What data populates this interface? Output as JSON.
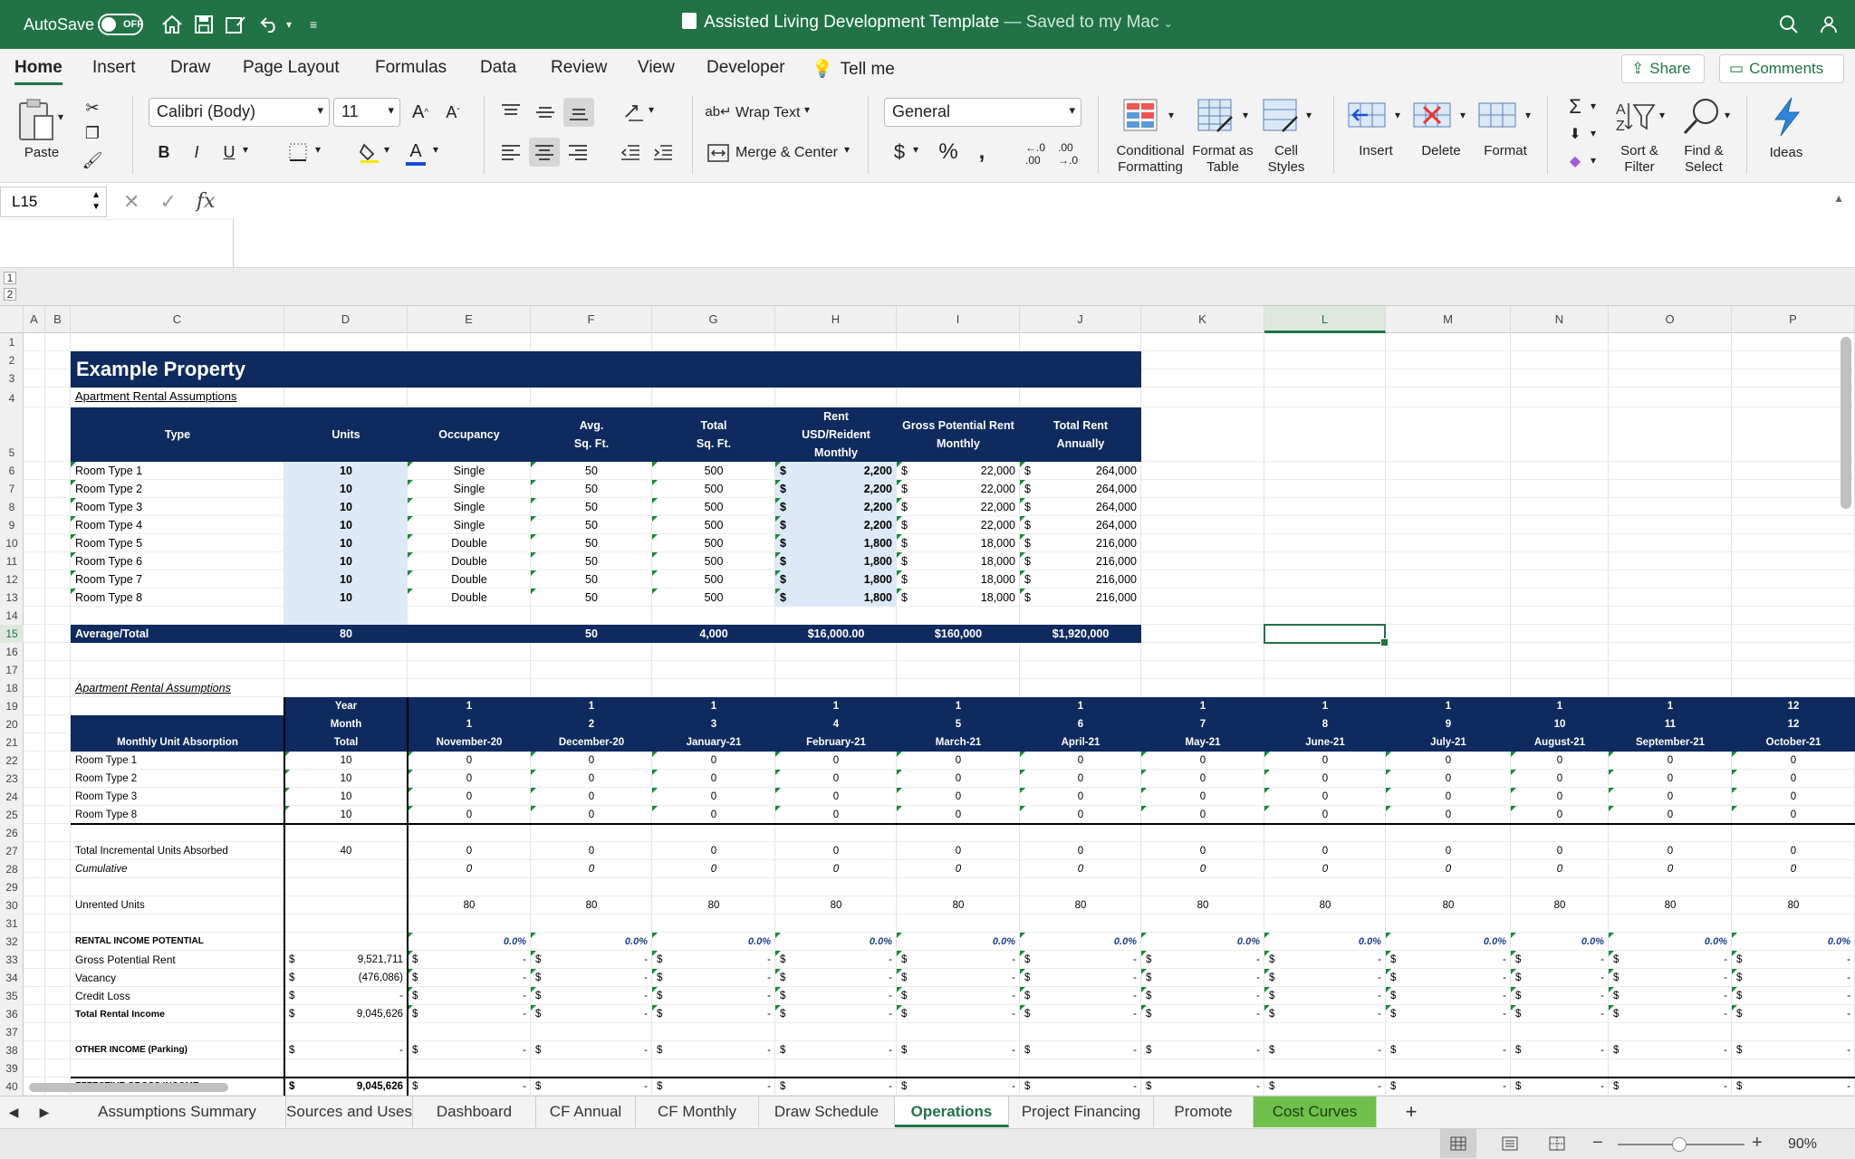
{
  "titlebar": {
    "autosave_label": "AutoSave",
    "autosave_state": "OFF",
    "doc_title": "Assisted Living Development Template",
    "saved_status": "— Saved to my Mac"
  },
  "ribbon_tabs": [
    "Home",
    "Insert",
    "Draw",
    "Page Layout",
    "Formulas",
    "Data",
    "Review",
    "View",
    "Developer",
    "Tell me"
  ],
  "share_label": "Share",
  "comments_label": "Comments",
  "ribbon": {
    "paste": "Paste",
    "font_name": "Calibri (Body)",
    "font_size": "11",
    "wrap_text": "Wrap Text",
    "merge_center": "Merge & Center",
    "number_format": "General",
    "conditional_formatting": "Conditional Formatting",
    "format_as_table": "Format as Table",
    "cell_styles": "Cell Styles",
    "insert": "Insert",
    "delete": "Delete",
    "format": "Format",
    "sort_filter": "Sort & Filter",
    "find_select": "Find & Select",
    "ideas": "Ideas"
  },
  "formula_bar": {
    "name_box": "L15",
    "fx": "fx",
    "value": ""
  },
  "outline_levels": [
    "1",
    "2"
  ],
  "column_letters": [
    "A",
    "B",
    "C",
    "D",
    "E",
    "F",
    "G",
    "H",
    "I",
    "J",
    "K",
    "L",
    "M",
    "N",
    "O",
    "P"
  ],
  "sheet": {
    "title": "Example Property",
    "section1_title": "Apartment Rental Assumptions",
    "headers": {
      "type": "Type",
      "units": "Units",
      "occupancy": "Occupancy",
      "sqft_1": "Avg.",
      "sqft_2": "Sq. Ft.",
      "total_1": "Total",
      "total_2": "Sq. Ft.",
      "rent_1": "Rent",
      "rent_2": "USD/Reident",
      "rent_3": "Monthly",
      "gpr_1": "Gross Potential Rent",
      "gpr_2": "Monthly",
      "tra_1": "Total Rent",
      "tra_2": "Annually"
    },
    "room_rows": [
      [
        "Room Type 1",
        "10",
        "Single",
        "50",
        "500",
        "$",
        "2,200",
        "$",
        "22,000",
        "$",
        "264,000"
      ],
      [
        "Room Type 2",
        "10",
        "Single",
        "50",
        "500",
        "$",
        "2,200",
        "$",
        "22,000",
        "$",
        "264,000"
      ],
      [
        "Room Type 3",
        "10",
        "Single",
        "50",
        "500",
        "$",
        "2,200",
        "$",
        "22,000",
        "$",
        "264,000"
      ],
      [
        "Room Type 4",
        "10",
        "Single",
        "50",
        "500",
        "$",
        "2,200",
        "$",
        "22,000",
        "$",
        "264,000"
      ],
      [
        "Room Type 5",
        "10",
        "Double",
        "50",
        "500",
        "$",
        "1,800",
        "$",
        "18,000",
        "$",
        "216,000"
      ],
      [
        "Room Type 6",
        "10",
        "Double",
        "50",
        "500",
        "$",
        "1,800",
        "$",
        "18,000",
        "$",
        "216,000"
      ],
      [
        "Room Type 7",
        "10",
        "Double",
        "50",
        "500",
        "$",
        "1,800",
        "$",
        "18,000",
        "$",
        "216,000"
      ],
      [
        "Room Type 8",
        "10",
        "Double",
        "50",
        "500",
        "$",
        "1,800",
        "$",
        "18,000",
        "$",
        "216,000"
      ]
    ],
    "total_row": [
      "Average/Total",
      "80",
      "",
      "50",
      "4,000",
      "$16,000.00",
      "$160,000",
      "$1,920,000"
    ],
    "section2_title": "Apartment Rental Assumptions",
    "abs_labels": {
      "year": "Year",
      "month": "Month",
      "total": "Total",
      "monthly_unit_absorption": "Monthly Unit Absorption"
    },
    "years": [
      "1",
      "1",
      "1",
      "1",
      "1",
      "1",
      "1",
      "1",
      "1",
      "1",
      "1",
      "12"
    ],
    "months": [
      "1",
      "2",
      "3",
      "4",
      "5",
      "6",
      "7",
      "8",
      "9",
      "10",
      "11",
      "12"
    ],
    "month_names": [
      "November-20",
      "December-20",
      "January-21",
      "February-21",
      "March-21",
      "April-21",
      "May-21",
      "June-21",
      "July-21",
      "August-21",
      "September-21",
      "October-21"
    ],
    "abs_rows": [
      {
        "label": "Room Type 1",
        "total": "10",
        "values": [
          "0",
          "0",
          "0",
          "0",
          "0",
          "0",
          "0",
          "0",
          "0",
          "0",
          "0",
          "0"
        ]
      },
      {
        "label": "Room Type 2",
        "total": "10",
        "values": [
          "0",
          "0",
          "0",
          "0",
          "0",
          "0",
          "0",
          "0",
          "0",
          "0",
          "0",
          "0"
        ]
      },
      {
        "label": "Room Type 3",
        "total": "10",
        "values": [
          "0",
          "0",
          "0",
          "0",
          "0",
          "0",
          "0",
          "0",
          "0",
          "0",
          "0",
          "0"
        ]
      },
      {
        "label": "Room Type 8",
        "total": "10",
        "values": [
          "0",
          "0",
          "0",
          "0",
          "0",
          "0",
          "0",
          "0",
          "0",
          "0",
          "0",
          "0"
        ]
      }
    ],
    "total_incremental": {
      "label": "Total Incremental Units Absorbed",
      "total": "40",
      "values": [
        "0",
        "0",
        "0",
        "0",
        "0",
        "0",
        "0",
        "0",
        "0",
        "0",
        "0",
        "0"
      ]
    },
    "cumulative": {
      "label": "Cumulative",
      "values": [
        "0",
        "0",
        "0",
        "0",
        "0",
        "0",
        "0",
        "0",
        "0",
        "0",
        "0",
        "0"
      ]
    },
    "unrented": {
      "label": "Unrented Units",
      "values": [
        "80",
        "80",
        "80",
        "80",
        "80",
        "80",
        "80",
        "80",
        "80",
        "80",
        "80",
        "80"
      ]
    },
    "rental_income_potential": "RENTAL INCOME POTENTIAL",
    "pct_values": [
      "0.0%",
      "0.0%",
      "0.0%",
      "0.0%",
      "0.0%",
      "0.0%",
      "0.0%",
      "0.0%",
      "0.0%",
      "0.0%",
      "0.0%",
      "0.0%"
    ],
    "income_rows": [
      {
        "label": "Gross Potential Rent",
        "cur": "$",
        "total": "9,521,711",
        "bold": false
      },
      {
        "label": "Vacancy",
        "cur": "$",
        "total": "(476,086)",
        "bold": false
      },
      {
        "label": "Credit Loss",
        "cur": "$",
        "total": "-",
        "bold": false
      },
      {
        "label": "Total Rental Income",
        "cur": "$",
        "total": "9,045,626",
        "bold": true
      }
    ],
    "other_income": {
      "label": "OTHER INCOME (Parking)",
      "cur": "$",
      "total": "-"
    },
    "egi": {
      "label": "EFFECTIVE GROSS INCOME",
      "cur": "$",
      "total": "9,045,626"
    },
    "dash": "-",
    "dollar": "$"
  },
  "sheet_tabs": [
    "Assumptions Summary",
    "Sources and Uses",
    "Dashboard",
    "CF Annual",
    "CF Monthly",
    "Draw Schedule",
    "Operations",
    "Project Financing",
    "Promote",
    "Cost Curves"
  ],
  "active_tab": "Operations",
  "zoom": "90%",
  "colors": {
    "excel_green": "#217346",
    "navy": "#0e2a5e",
    "light_blue": "#dde9f6",
    "cost_curves_tab": "#70c04c"
  }
}
